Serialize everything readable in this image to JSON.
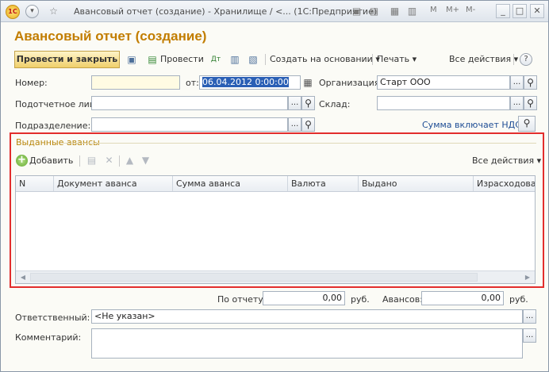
{
  "window": {
    "title": "Авансовый отчет (создание) - Хранилище / <...  (1С:Предприятие)",
    "menu_labels": [
      "M",
      "M+",
      "M-"
    ],
    "minimize": "_",
    "maximize": "□",
    "close": "✕"
  },
  "document": {
    "title": "Авансовый отчет (создание)"
  },
  "toolbar": {
    "post_and_close": "Провести и закрыть",
    "post": "Провести",
    "create_based_on": "Создать на основании",
    "print": "Печать",
    "all_actions": "Все действия",
    "help": "?"
  },
  "form": {
    "number_label": "Номер:",
    "number_value": "",
    "date_label": "от:",
    "date_value": "06.04.2012  0:00:00",
    "organization_label": "Организация:",
    "organization_value": "Старт ООО",
    "accountable_label": "Подотчетное лицо:",
    "accountable_value": "",
    "warehouse_label": "Склад:",
    "warehouse_value": "",
    "department_label": "Подразделение:",
    "department_value": "",
    "vat_link": "Сумма включает НДС"
  },
  "advances": {
    "group_title": "Выданные авансы",
    "add": "Добавить",
    "all_actions": "Все действия",
    "columns": [
      "N",
      "Документ аванса",
      "Сумма аванса",
      "Валюта",
      "Выдано",
      "Израсходовано"
    ],
    "rows": []
  },
  "totals": {
    "by_report_label": "По отчету:",
    "by_report_value": "0,00",
    "currency1": "руб.",
    "advances_label": "Авансов:",
    "advances_value": "0,00",
    "currency2": "руб."
  },
  "footer": {
    "responsible_label": "Ответственный:",
    "responsible_value": "<Не указан>",
    "comment_label": "Комментарий:",
    "comment_value": ""
  },
  "colors": {
    "accent_title": "#c27d00",
    "highlight_border": "#e22d2d",
    "link": "#1e4d95"
  }
}
